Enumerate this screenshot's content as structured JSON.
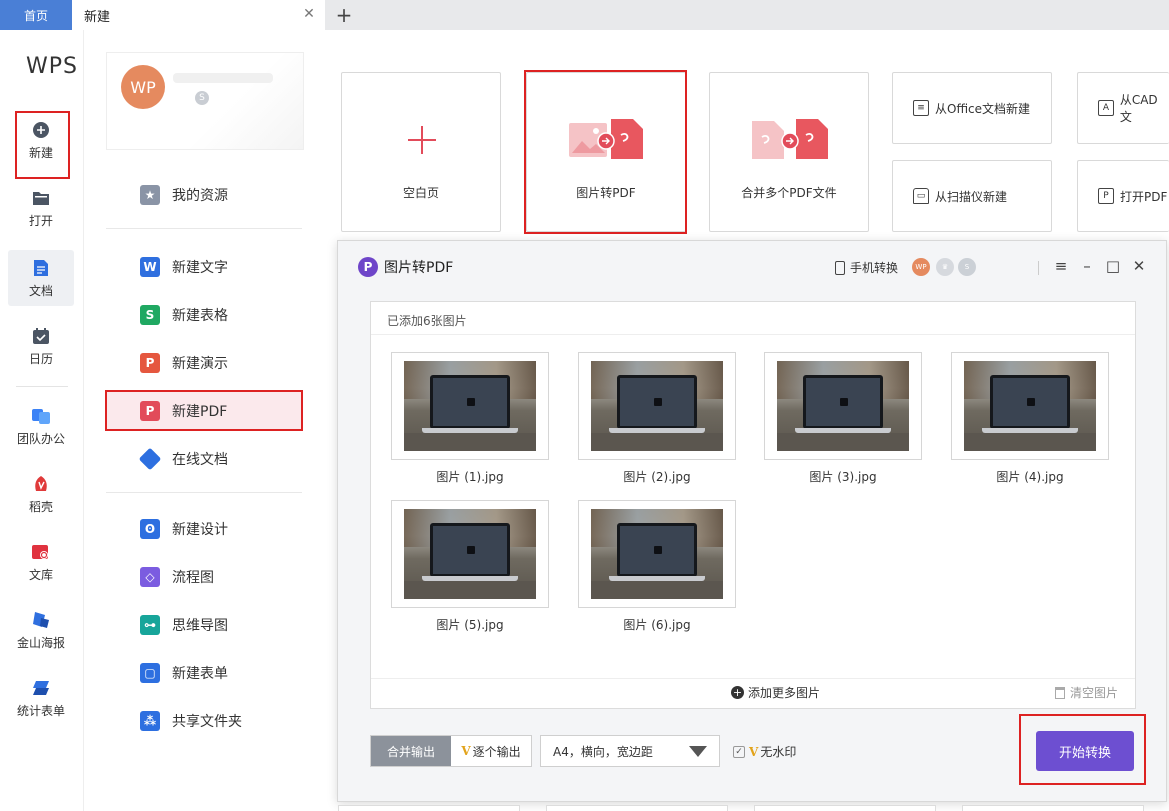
{
  "tabs": {
    "home": "首页",
    "new": "新建",
    "close": "✕",
    "add": "+"
  },
  "logo": "WPS",
  "leftnav": [
    {
      "label": "新建",
      "icon": "plus-circle-icon"
    },
    {
      "label": "打开",
      "icon": "folder-icon"
    },
    {
      "label": "文档",
      "icon": "document-icon"
    },
    {
      "label": "日历",
      "icon": "calendar-icon"
    },
    {
      "label": "团队办公",
      "icon": "team-icon"
    },
    {
      "label": "稻壳",
      "icon": "docer-icon"
    },
    {
      "label": "文库",
      "icon": "library-icon"
    },
    {
      "label": "金山海报",
      "icon": "poster-icon"
    },
    {
      "label": "统计表单",
      "icon": "form-icon"
    }
  ],
  "user": {
    "avatar": "WP",
    "badge": "S"
  },
  "menu": [
    {
      "label": "我的资源",
      "icon": "star-icon",
      "color": "#8a94a6"
    },
    {
      "label": "新建文字",
      "icon": "word-icon",
      "color": "#2f6fdf",
      "glyph": "W"
    },
    {
      "label": "新建表格",
      "icon": "sheet-icon",
      "color": "#1fa862",
      "glyph": "S"
    },
    {
      "label": "新建演示",
      "icon": "slides-icon",
      "color": "#e5573f",
      "glyph": "P"
    },
    {
      "label": "新建PDF",
      "icon": "pdf-icon",
      "color": "#e24b5a",
      "glyph": "P"
    },
    {
      "label": "在线文档",
      "icon": "online-doc-icon",
      "color": "#2d6fe0"
    },
    {
      "label": "新建设计",
      "icon": "design-icon",
      "color": "#2d6fe0"
    },
    {
      "label": "流程图",
      "icon": "flowchart-icon",
      "color": "#7b5ce0"
    },
    {
      "label": "思维导图",
      "icon": "mindmap-icon",
      "color": "#17a59a"
    },
    {
      "label": "新建表单",
      "icon": "form-new-icon",
      "color": "#2d6fe0"
    },
    {
      "label": "共享文件夹",
      "icon": "shared-folder-icon",
      "color": "#2d6fe0"
    }
  ],
  "cards": {
    "blank": "空白页",
    "img2pdf": "图片转PDF",
    "merge": "合并多个PDF文件",
    "from_office": "从Office文档新建",
    "from_cad": "从CAD文",
    "from_scanner": "从扫描仪新建",
    "open_pdf": "打开PDF"
  },
  "dialog": {
    "title": "图片转PDF",
    "phone": "手机转换",
    "avatar": "WP",
    "count_text": "已添加6张图片",
    "images": [
      "图片 (1).jpg",
      "图片 (2).jpg",
      "图片 (3).jpg",
      "图片 (4).jpg",
      "图片 (5).jpg",
      "图片 (6).jpg"
    ],
    "add_more": "添加更多图片",
    "clear": "清空图片",
    "merge_output": "合并输出",
    "single_output": "逐个输出",
    "vip_mark": "V",
    "page_setting": "A4，横向，宽边距",
    "watermark": "无水印",
    "start": "开始转换",
    "accent": "#6d4fd1"
  }
}
